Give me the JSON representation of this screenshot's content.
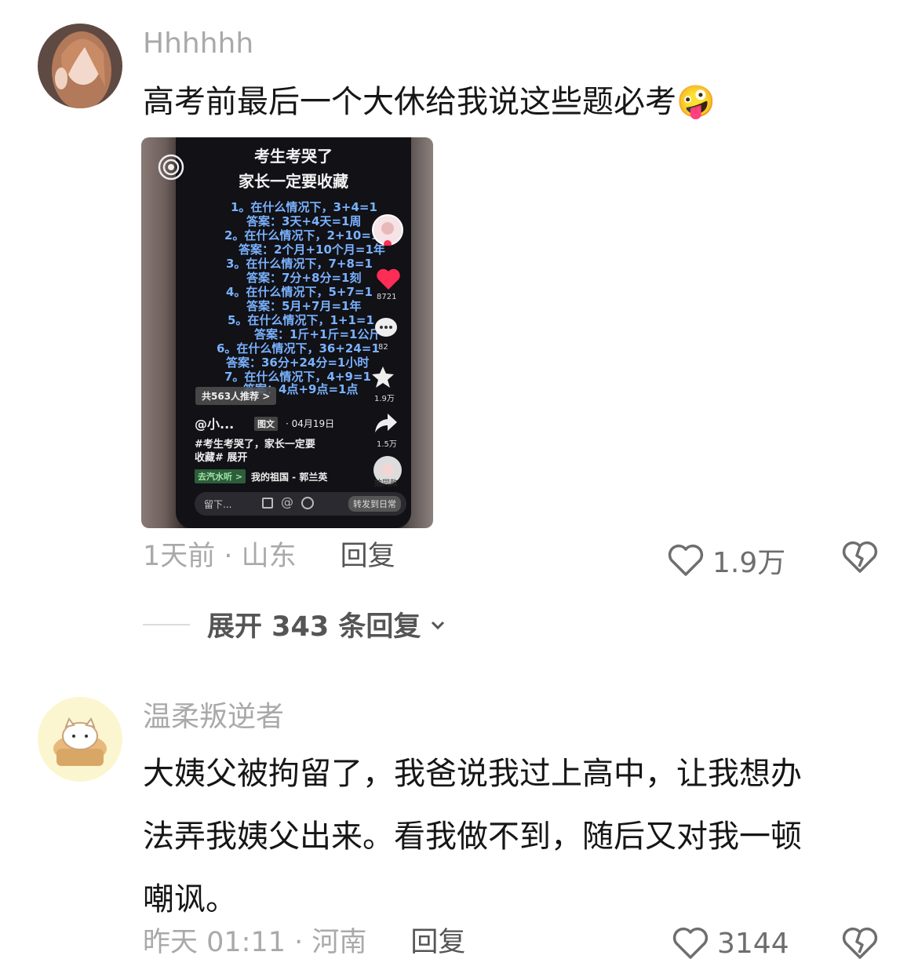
{
  "comments": [
    {
      "username": "Hhhhhh",
      "text": "高考前最后一个大休给我说这些题必考",
      "emoji": "🤪",
      "meta": "1天前 · 山东",
      "reply_label": "回复",
      "like_count": "1.9万",
      "attached_image": {
        "title_line1": "考生考哭了",
        "title_line2": "家长一定要收藏",
        "lines": [
          "1。在什么情况下，3+4=1",
          "答案：3天+4天=1周",
          "2。在什么情况下，2+10=1",
          "答案：2个月+10个月=1年",
          "3。在什么情况下，7+8=1",
          "答案：7分+8分=1刻",
          "4。在什么情况下，5+7=1",
          "答案：5月+7月=1年",
          "5。在什么情况下，1+1=1",
          "答案：1斤+1斤=1公斤",
          "6。在什么情况下，36+24=1",
          "答案：36分+24分=1小时",
          "7。在什么情况下，4+9=1",
          "答案：4点+9点=1点"
        ],
        "like_count": "8721",
        "comment_count": "82",
        "fav_count": "1.9万",
        "share_count": "1.5万",
        "recommend": "共563人推荐 >",
        "author": "@小...",
        "post_type": "图文",
        "date": "· 04月19日",
        "caption_line1": "#考生考哭了，家长一定要",
        "caption_line2": "收藏# 展开",
        "music_tag": "去汽水听 >",
        "music_name": "我的祖国 - 郭兰英",
        "input_placeholder": "留下...",
        "forward_label": "转发到日常",
        "side_label": "拍同款"
      }
    },
    {
      "username": "温柔叛逆者",
      "text_line1": "大姨父被拘留了，我爸说我过上高中，让我想办",
      "text_line2": "法弄我姨父出来。看我做不到，随后又对我一顿",
      "text_line3": "嘲讽。",
      "meta": "昨天 01:11 · 河南",
      "reply_label": "回复",
      "like_count": "3144"
    }
  ],
  "expand_replies": "展开 343 条回复",
  "colors": {
    "text": "#161616",
    "muted": "#a9a9a9",
    "phone_text": "#7ab2ff",
    "heart": "#ff2d55"
  }
}
